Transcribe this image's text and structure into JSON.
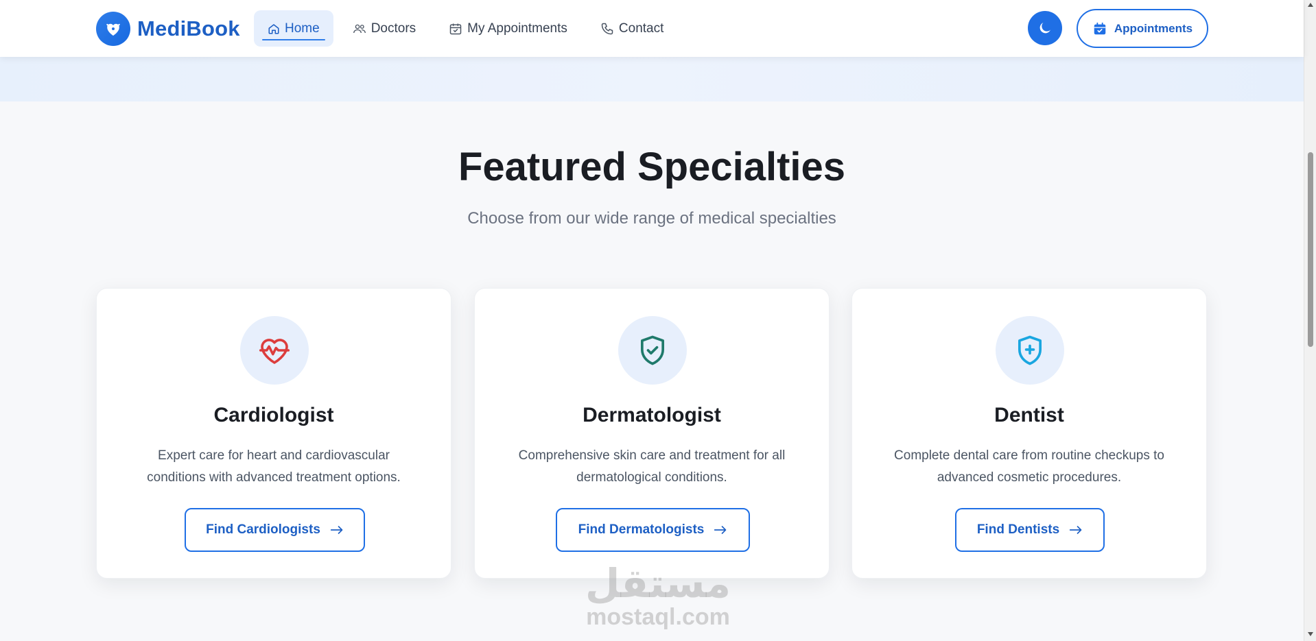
{
  "brand": {
    "name": "MediBook",
    "logo_icon": "heart-hand-icon"
  },
  "nav": {
    "items": [
      {
        "label": "Home",
        "icon": "home-icon",
        "active": true
      },
      {
        "label": "Doctors",
        "icon": "users-icon",
        "active": false
      },
      {
        "label": "My Appointments",
        "icon": "calendar-check-icon",
        "active": false
      },
      {
        "label": "Contact",
        "icon": "phone-icon",
        "active": false
      }
    ]
  },
  "header_actions": {
    "theme_toggle_icon": "moon-icon",
    "appointments_label": "Appointments",
    "appointments_icon": "calendar-check-icon"
  },
  "section": {
    "title": "Featured Specialties",
    "subtitle": "Choose from our wide range of medical specialties"
  },
  "specialties": [
    {
      "title": "Cardiologist",
      "description": "Expert care for heart and cardiovascular conditions with advanced treatment options.",
      "button_label": "Find Cardiologists",
      "icon": "heart-pulse-icon",
      "icon_color": "#dc3d3d"
    },
    {
      "title": "Dermatologist",
      "description": "Comprehensive skin care and treatment for all dermatological conditions.",
      "button_label": "Find Dermatologists",
      "icon": "shield-check-icon",
      "icon_color": "#1f7a6b"
    },
    {
      "title": "Dentist",
      "description": "Complete dental care from routine checkups to advanced cosmetic procedures.",
      "button_label": "Find Dentists",
      "icon": "shield-plus-icon",
      "icon_color": "#19a6e0"
    }
  ],
  "watermark": {
    "arabic": "مستقل",
    "latin": "mostaql.com"
  },
  "colors": {
    "accent": "#1f6fe5",
    "brand_text": "#1d5fc4",
    "page_bg": "#f7f8fa"
  }
}
